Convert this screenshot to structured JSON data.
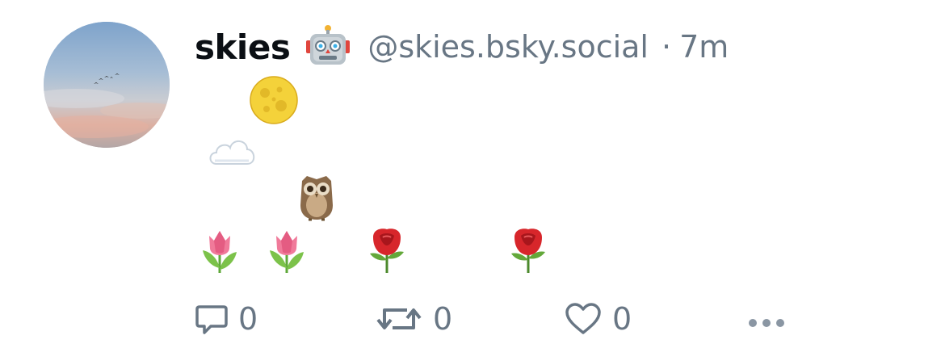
{
  "post": {
    "display_name": "skies",
    "handle": "@skies.bsky.social",
    "separator": "·",
    "time": "7m",
    "badge_icon": "robot-icon"
  },
  "body_emojis": [
    "full-moon-icon",
    "cloud-icon",
    "owl-icon",
    "tulip-icon",
    "tulip-icon",
    "rose-icon",
    "rose-icon"
  ],
  "actions": {
    "reply_count": "0",
    "repost_count": "0",
    "like_count": "0",
    "more_icon": "ellipsis-icon"
  },
  "colors": {
    "text_primary": "#0b0f14",
    "text_secondary": "#687684"
  }
}
